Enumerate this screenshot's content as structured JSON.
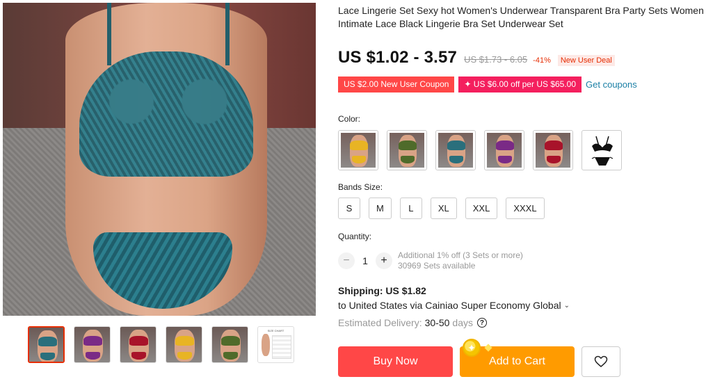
{
  "product": {
    "title": "Lace Lingerie Set Sexy hot Women's Underwear Transparent Bra Party Sets Women Intimate Lace Black Lingerie Bra Set Underwear Set"
  },
  "price": {
    "current": "US $1.02 - 3.57",
    "original": "US $1.73 - 6.05",
    "discount": "-41%",
    "deal_label": "New User Deal"
  },
  "coupons": {
    "new_user": "US $2.00 New User Coupon",
    "store": "✦ US $6.00 off per US $65.00",
    "get_link": "Get coupons"
  },
  "color": {
    "label": "Color:",
    "options": [
      {
        "name": "yellow",
        "hex": "#e8b424"
      },
      {
        "name": "green",
        "hex": "#4f6b2a"
      },
      {
        "name": "blue",
        "hex": "#2a6f7c"
      },
      {
        "name": "purple",
        "hex": "#7a2a86"
      },
      {
        "name": "red",
        "hex": "#a8132a"
      },
      {
        "name": "black",
        "hex": "#111111"
      }
    ]
  },
  "size": {
    "label": "Bands Size:",
    "options": [
      "S",
      "M",
      "L",
      "XL",
      "XXL",
      "XXXL"
    ]
  },
  "quantity": {
    "label": "Quantity:",
    "value": "1",
    "decrement": "−",
    "increment": "+",
    "bulk_note": "Additional 1% off (3 Sets or more)",
    "available": "30969 Sets available"
  },
  "shipping": {
    "title": "Shipping: US $1.82",
    "method": "to United States via Cainiao Super Economy Global",
    "delivery_label": "Estimated Delivery:",
    "delivery_value": "30-50",
    "delivery_unit": "days"
  },
  "actions": {
    "buy_now": "Buy Now",
    "add_to_cart": "Add to Cart"
  },
  "gallery": {
    "thumbs": [
      {
        "name": "blue",
        "hex": "#2a6f7c"
      },
      {
        "name": "purple",
        "hex": "#7a2a86"
      },
      {
        "name": "red",
        "hex": "#a8132a"
      },
      {
        "name": "yellow",
        "hex": "#e8b424"
      },
      {
        "name": "green",
        "hex": "#4f6b2a"
      }
    ],
    "size_chart_title": "SIZE CHART"
  },
  "colors": {
    "accent_red": "#ff4747",
    "accent_pink": "#f41f5e",
    "accent_orange": "#ff9b00",
    "link_blue": "#1a7fa5"
  }
}
